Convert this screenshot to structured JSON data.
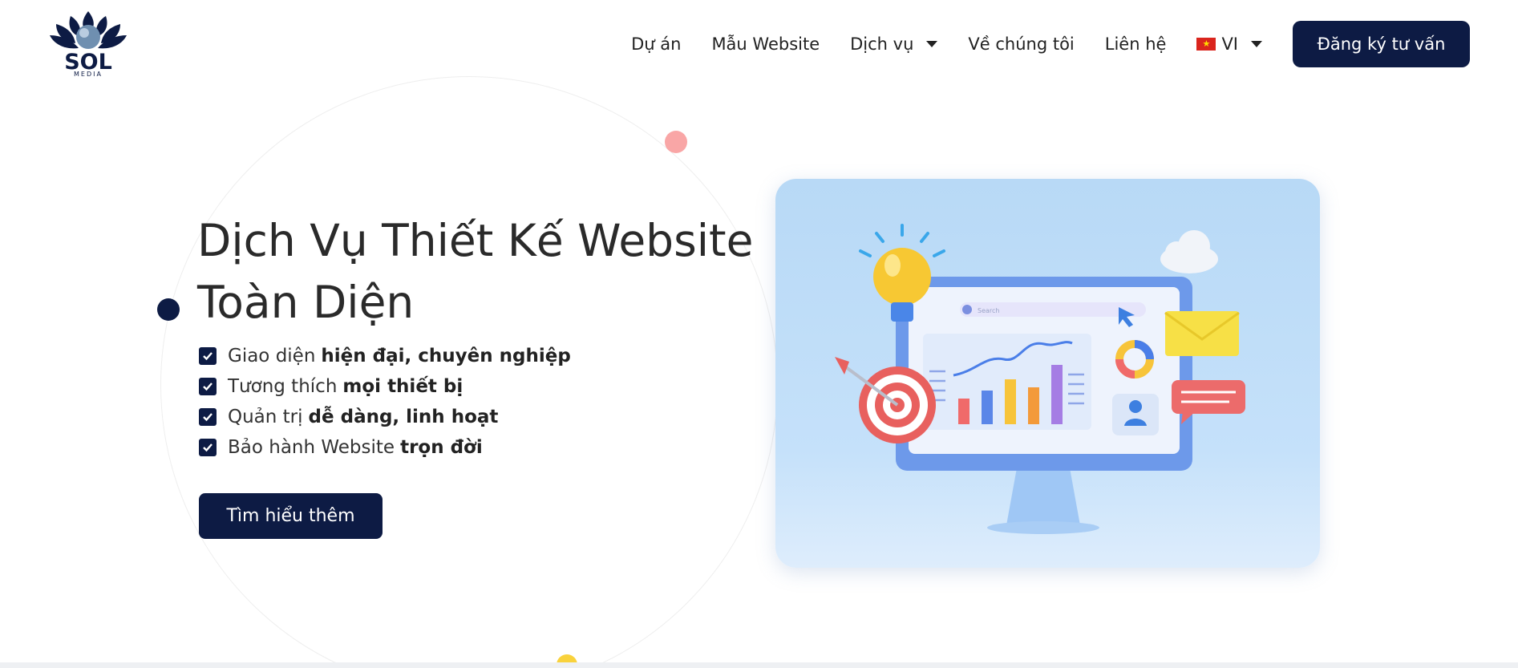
{
  "header": {
    "logo": {
      "text": "SOL",
      "subtext": "MEDIA"
    },
    "nav": [
      {
        "label": "Dự án",
        "has_dropdown": false
      },
      {
        "label": "Mẫu Website",
        "has_dropdown": false
      },
      {
        "label": "Dịch vụ",
        "has_dropdown": true
      },
      {
        "label": "Về chúng tôi",
        "has_dropdown": false
      },
      {
        "label": "Liên hệ",
        "has_dropdown": false
      }
    ],
    "language": {
      "code": "VI",
      "flag_icon": "vietnam-flag-icon"
    },
    "cta_label": "Đăng ký tư vấn"
  },
  "hero": {
    "title_line1": "Dịch Vụ Thiết Kế Website",
    "title_line2": "Toàn Diện",
    "features": [
      {
        "text": "Giao diện",
        "bold": "hiện đại, chuyên nghiệp"
      },
      {
        "text": "Tương thích",
        "bold": "mọi thiết bị"
      },
      {
        "text": "Quản trị",
        "bold": "dễ dàng, linh hoạt"
      },
      {
        "text": "Bảo hành Website",
        "bold": "trọn đời"
      }
    ],
    "button_label": "Tìm hiểu thêm",
    "illustration": {
      "search_placeholder": "Search"
    }
  },
  "colors": {
    "primary": "#0d1b44",
    "accent_pink": "#f9a6a6",
    "accent_yellow": "#f9d23c",
    "illustration_bg": "#b8d9f6"
  },
  "icons": [
    "check-icon",
    "caret-down-icon",
    "vietnam-flag-icon",
    "lightbulb-icon",
    "target-icon",
    "cloud-icon",
    "envelope-icon",
    "chat-bubble-icon",
    "user-icon",
    "donut-chart-icon",
    "cursor-icon",
    "search-icon"
  ]
}
